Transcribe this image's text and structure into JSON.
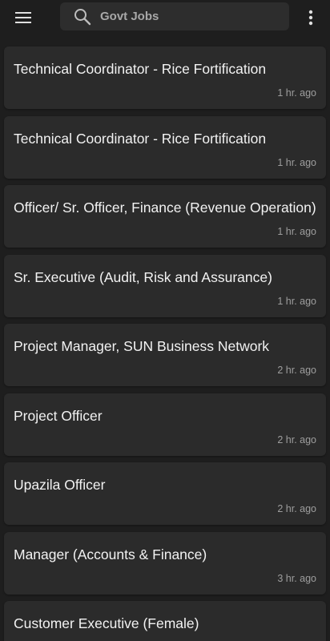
{
  "topbar": {
    "menu_icon": "hamburger-menu-icon",
    "search": {
      "icon": "search-icon",
      "value": "",
      "placeholder": "Govt Jobs"
    },
    "more_icon": "more-vertical-icon"
  },
  "jobs": [
    {
      "title": "Technical Coordinator - Rice Fortification",
      "time": "1 hr. ago"
    },
    {
      "title": "Technical Coordinator - Rice Fortification",
      "time": "1 hr. ago"
    },
    {
      "title": "Officer/ Sr. Officer, Finance (Revenue Operation)",
      "time": "1 hr. ago"
    },
    {
      "title": "Sr. Executive (Audit, Risk and Assurance)",
      "time": "1 hr. ago"
    },
    {
      "title": "Project Manager, SUN Business Network",
      "time": "2 hr. ago"
    },
    {
      "title": "Project Officer",
      "time": "2 hr. ago"
    },
    {
      "title": "Upazila Officer",
      "time": "2 hr. ago"
    },
    {
      "title": "Manager (Accounts & Finance)",
      "time": "3 hr. ago"
    },
    {
      "title": "Customer Executive (Female)",
      "time": ""
    }
  ],
  "colors": {
    "background": "#1e1e1e",
    "card": "#2b2b2b",
    "search_field": "#2d2d2d",
    "title_text": "#f2f2f2",
    "time_text": "#9e9e9e"
  }
}
